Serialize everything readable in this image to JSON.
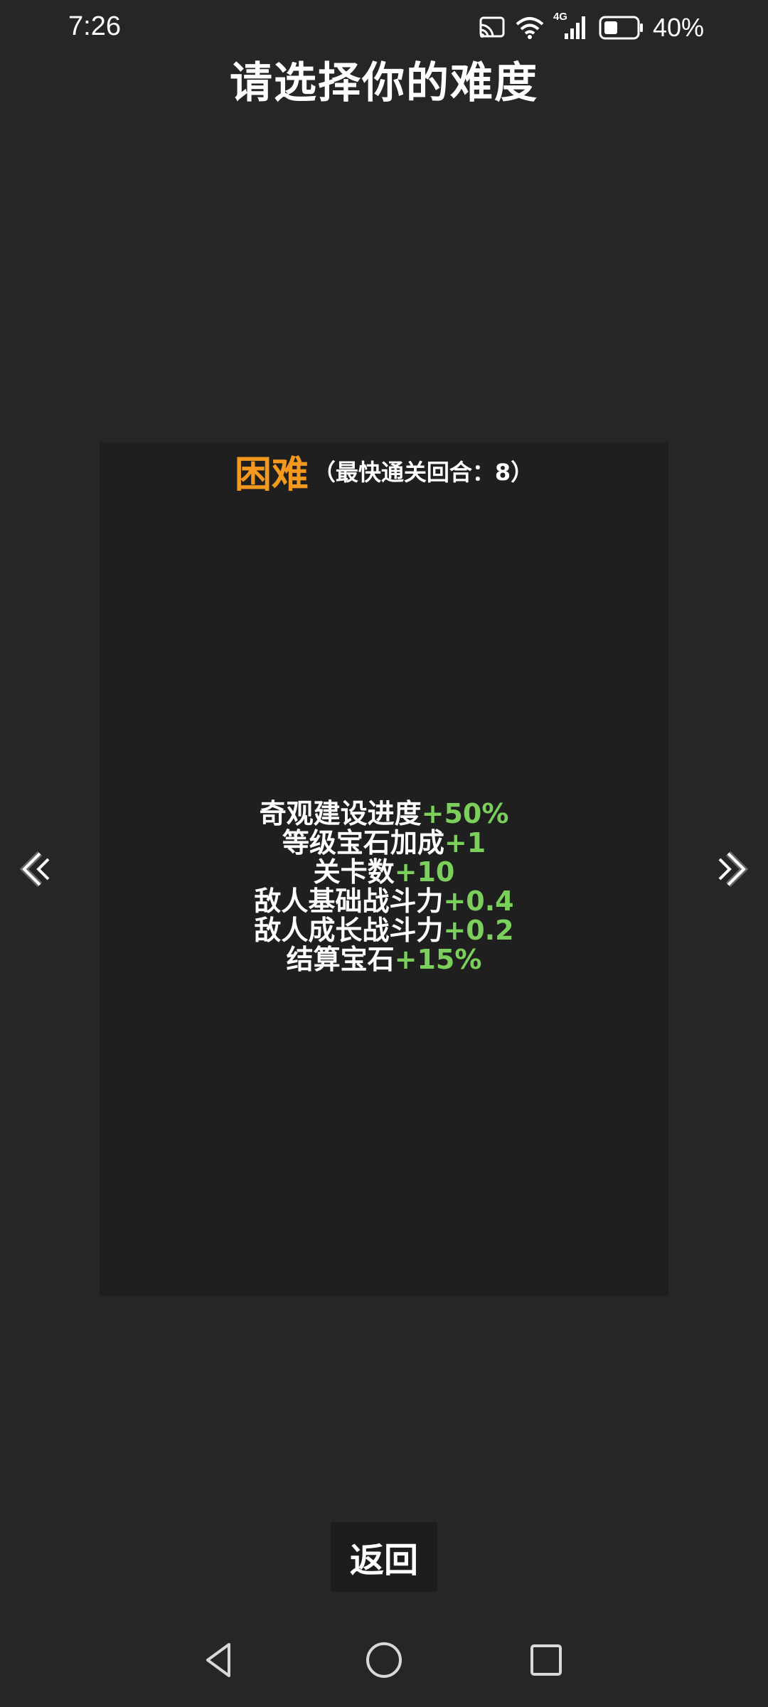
{
  "status_bar": {
    "time": "7:26",
    "network": "4G",
    "battery": "40%",
    "icons": [
      "cast-icon",
      "wifi-icon",
      "signal-icon",
      "battery-icon"
    ]
  },
  "title": "请选择你的难度",
  "difficulty": {
    "name": "困难",
    "clear_hint": "（最快通关回合：8）",
    "name_color": "#f39a1e",
    "value_color": "#7ad05a",
    "stats": [
      {
        "label": "奇观建设进度",
        "value": "+50%"
      },
      {
        "label": "等级宝石加成",
        "value": "+1"
      },
      {
        "label": "关卡数",
        "value": "+10"
      },
      {
        "label": "敌人基础战斗力",
        "value": "+0.4"
      },
      {
        "label": "敌人成长战斗力",
        "value": "+0.2"
      },
      {
        "label": "结算宝石",
        "value": "+15%"
      }
    ]
  },
  "navigation": {
    "prev_icon": "chevron-left-icon",
    "next_icon": "chevron-right-icon"
  },
  "back_button": {
    "label": "返回"
  },
  "system_nav": {
    "icons": [
      "nav-back-triangle-icon",
      "nav-home-circle-icon",
      "nav-recent-square-icon"
    ]
  }
}
